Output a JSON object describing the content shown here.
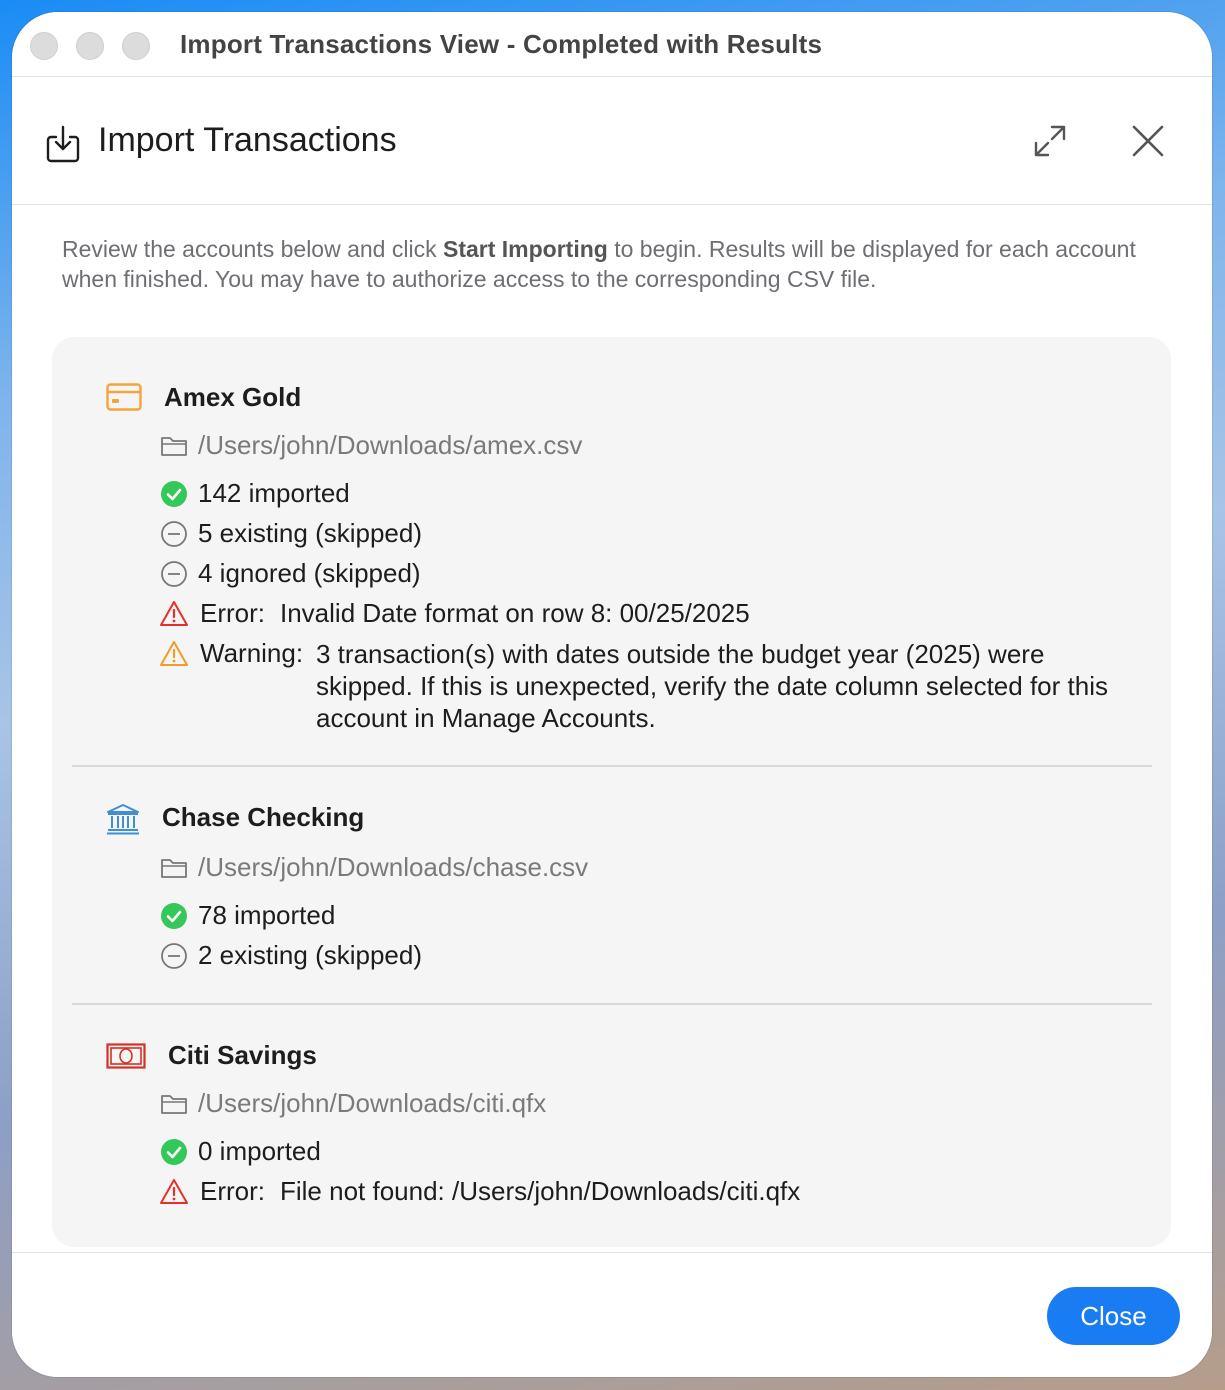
{
  "window": {
    "title": "Import Transactions View - Completed with Results"
  },
  "header": {
    "title": "Import Transactions",
    "icon": "import-icon",
    "expand_icon": "expand-icon",
    "close_icon": "close-icon"
  },
  "instructions": {
    "before": "Review the accounts below and click ",
    "bold": "Start Importing",
    "after": " to begin. Results will be displayed for each account when finished. You may have to authorize access to the corresponding CSV file."
  },
  "accounts": [
    {
      "name": "Amex Gold",
      "icon": "credit-card-icon",
      "icon_color": "#f5a43a",
      "path": "/Users/john/Downloads/amex.csv",
      "results": [
        {
          "type": "imported",
          "text": "142 imported"
        },
        {
          "type": "skipped",
          "text": "5 existing (skipped)"
        },
        {
          "type": "skipped",
          "text": "4 ignored (skipped)"
        },
        {
          "type": "error",
          "label": "Error:",
          "text": "Invalid Date format on row 8: 00/25/2025"
        },
        {
          "type": "warning",
          "label": "Warning:",
          "text": "3 transaction(s) with dates outside the budget year (2025) were skipped. If this is unexpected, verify the date column selected for this account in Manage Accounts."
        }
      ]
    },
    {
      "name": "Chase Checking",
      "icon": "bank-icon",
      "icon_color": "#3f8fd2",
      "path": "/Users/john/Downloads/chase.csv",
      "results": [
        {
          "type": "imported",
          "text": "78 imported"
        },
        {
          "type": "skipped",
          "text": "2 existing (skipped)"
        }
      ]
    },
    {
      "name": "Citi Savings",
      "icon": "banknote-icon",
      "icon_color": "#d93025",
      "path": "/Users/john/Downloads/citi.qfx",
      "results": [
        {
          "type": "imported",
          "text": "0 imported"
        },
        {
          "type": "error",
          "label": "Error:",
          "text": "File not found: /Users/john/Downloads/citi.qfx"
        }
      ]
    }
  ],
  "footer": {
    "close_label": "Close"
  },
  "colors": {
    "accent": "#1a7cf2",
    "success": "#34c759",
    "error": "#e5302a",
    "warning": "#f39a2b"
  }
}
